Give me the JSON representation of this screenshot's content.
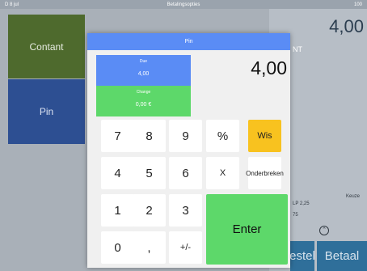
{
  "statusbar": {
    "left": "D 8 jul",
    "center": "Betalingsopties",
    "right": "100"
  },
  "background": {
    "side_buttons": {
      "contant": "Contant",
      "pin": "Pin"
    },
    "total": "4,00",
    "label_nt": "NT",
    "line1": "LP 2,25",
    "line2": "75",
    "small_right": "Keuze",
    "bottom_buttons": {
      "left": "estel",
      "right": "Betaal"
    }
  },
  "modal": {
    "title": "Pin",
    "due_label": "Due",
    "due_value": "4,00",
    "change_label": "Change",
    "change_value": "0,00 €",
    "amount": "4,00",
    "keys": {
      "k7": "7",
      "k8": "8",
      "k9": "9",
      "percent": "%",
      "wis": "Wis",
      "k4": "4",
      "k5": "5",
      "k6": "6",
      "x": "X",
      "onderbreken": "Onderbreken",
      "k1": "1",
      "k2": "2",
      "k3": "3",
      "enter": "Enter",
      "k0": "0",
      "comma": ",",
      "plusminus": "+/-"
    }
  },
  "colors": {
    "header_blue": "#5a8cf5",
    "due_blue": "#5a8cf5",
    "change_green": "#5dd86a",
    "enter_green": "#5dd86a",
    "wis_yellow": "#f8c21f",
    "contant_green": "#4e6a2d",
    "pin_blue": "#2d4f92"
  }
}
